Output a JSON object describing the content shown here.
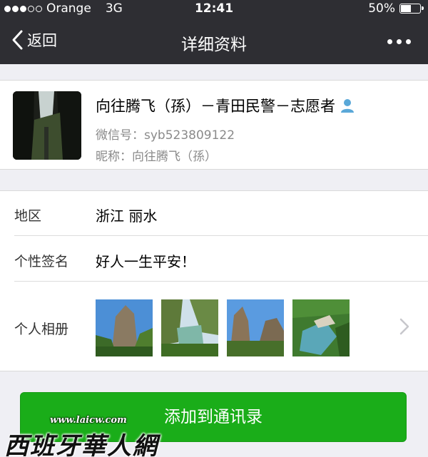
{
  "status_bar": {
    "carrier": "Orange",
    "network": "3G",
    "time": "12:41",
    "battery": "50%",
    "battery_level": 0.5
  },
  "nav": {
    "back_label": "返回",
    "title": "详细资料",
    "more_icon": "more-dots-icon"
  },
  "profile": {
    "name": "向往腾飞（孫）－青田民警－志愿者",
    "wechat_id_label": "微信号：",
    "wechat_id": "syb523809122",
    "nickname_label": "昵称：",
    "nickname": "向往腾飞（孫）"
  },
  "details": [
    {
      "label": "地区",
      "value": "浙江  丽水"
    },
    {
      "label": "个性签名",
      "value": "好人一生平安！"
    },
    {
      "label": "个人相册",
      "value": ""
    }
  ],
  "add_button_label": "添加到通讯录",
  "watermark": {
    "url": "www.laicw.com",
    "name": "西班牙華人網"
  },
  "colors": {
    "nav_bg": "#2e2e33",
    "button_green": "#1aad19",
    "page_bg": "#efeff4"
  }
}
